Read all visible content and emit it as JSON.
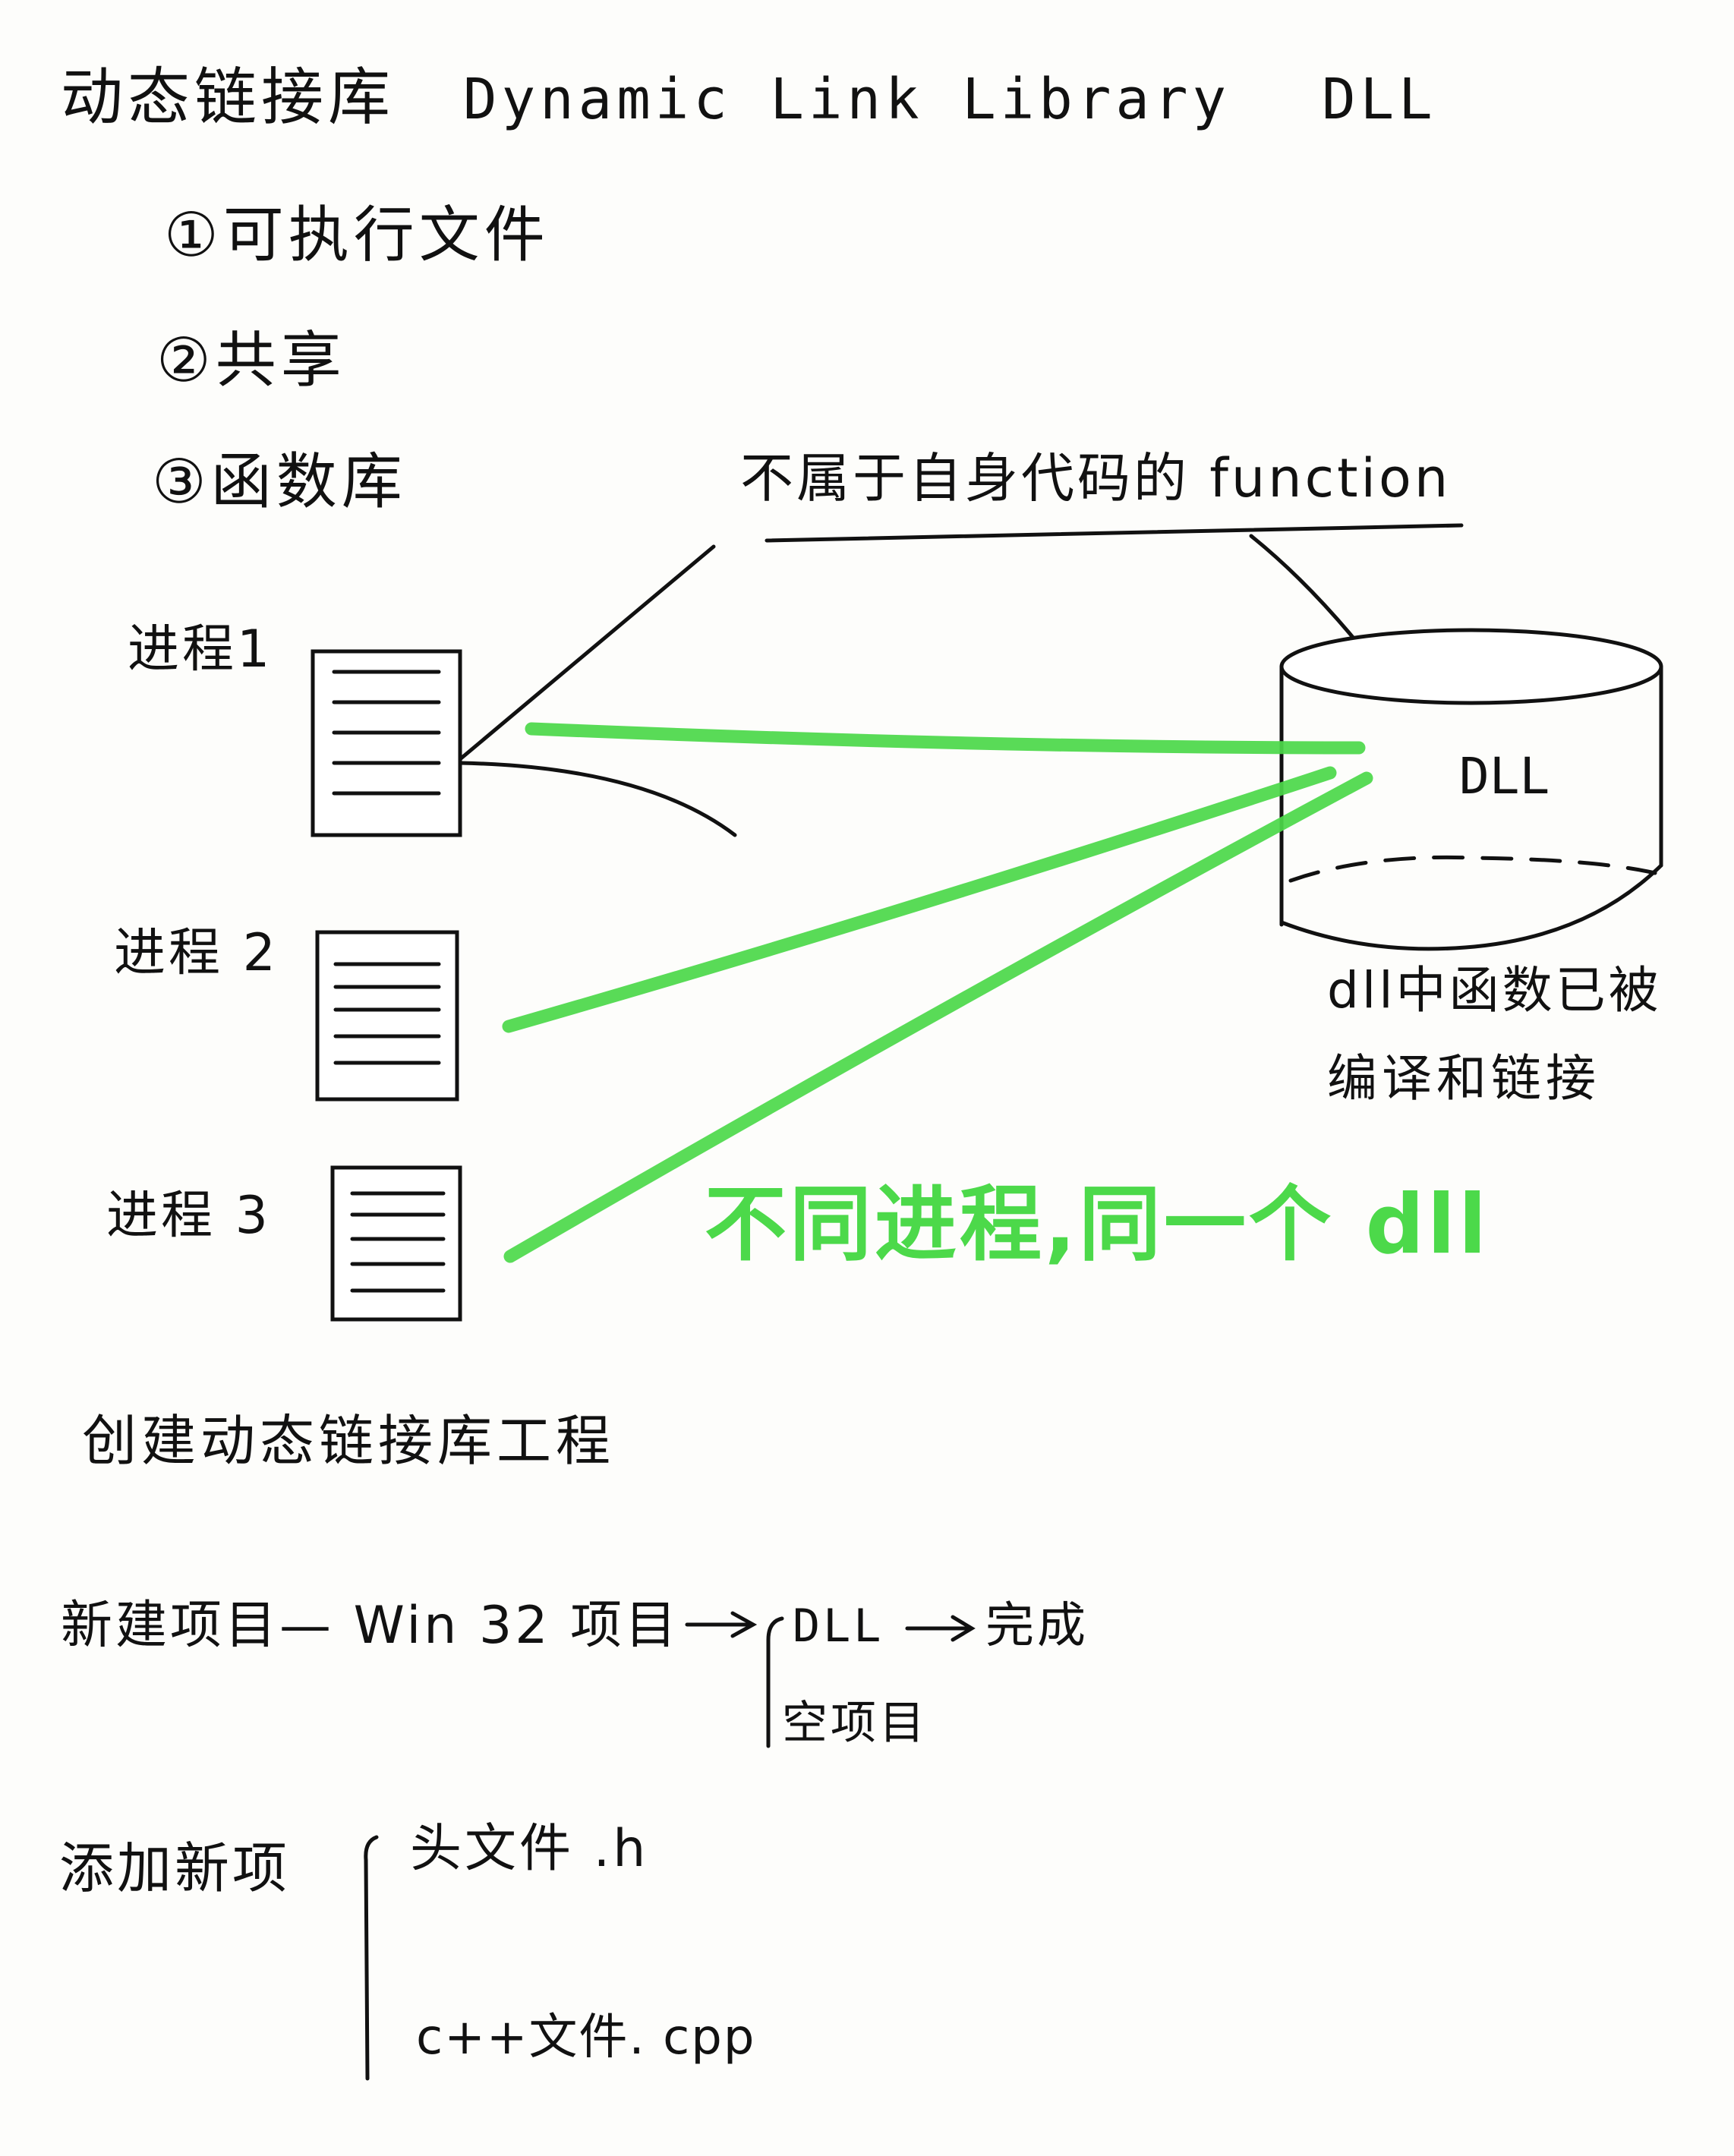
{
  "title": {
    "zh": "动态链接库",
    "en": "Dynamic  Link  Library",
    "abbr": "DLL"
  },
  "features": [
    "①可执行文件",
    "②共享",
    "③函数库"
  ],
  "annotation_function": "不属于自身代码的 function",
  "processes": [
    "进程1",
    "进程 2",
    "进程 3"
  ],
  "dll_label": "DLL",
  "dll_note": [
    "dll中函数已被",
    "编译和链接"
  ],
  "shared_note": "不同进程,同一个 dll",
  "create_project": {
    "heading": "创建动态链接库工程",
    "new_project": "新建项目— Win 32 项目",
    "option_dll": "DLL",
    "option_done": "完成",
    "option_empty": "空项目"
  },
  "add_item": {
    "heading": "添加新项",
    "header_file": "头文件 .h",
    "cpp_file": "c++文件. cpp"
  },
  "colors": {
    "ink": "#111111",
    "highlight": "#4cd94a",
    "paper": "#fdfdfb"
  }
}
